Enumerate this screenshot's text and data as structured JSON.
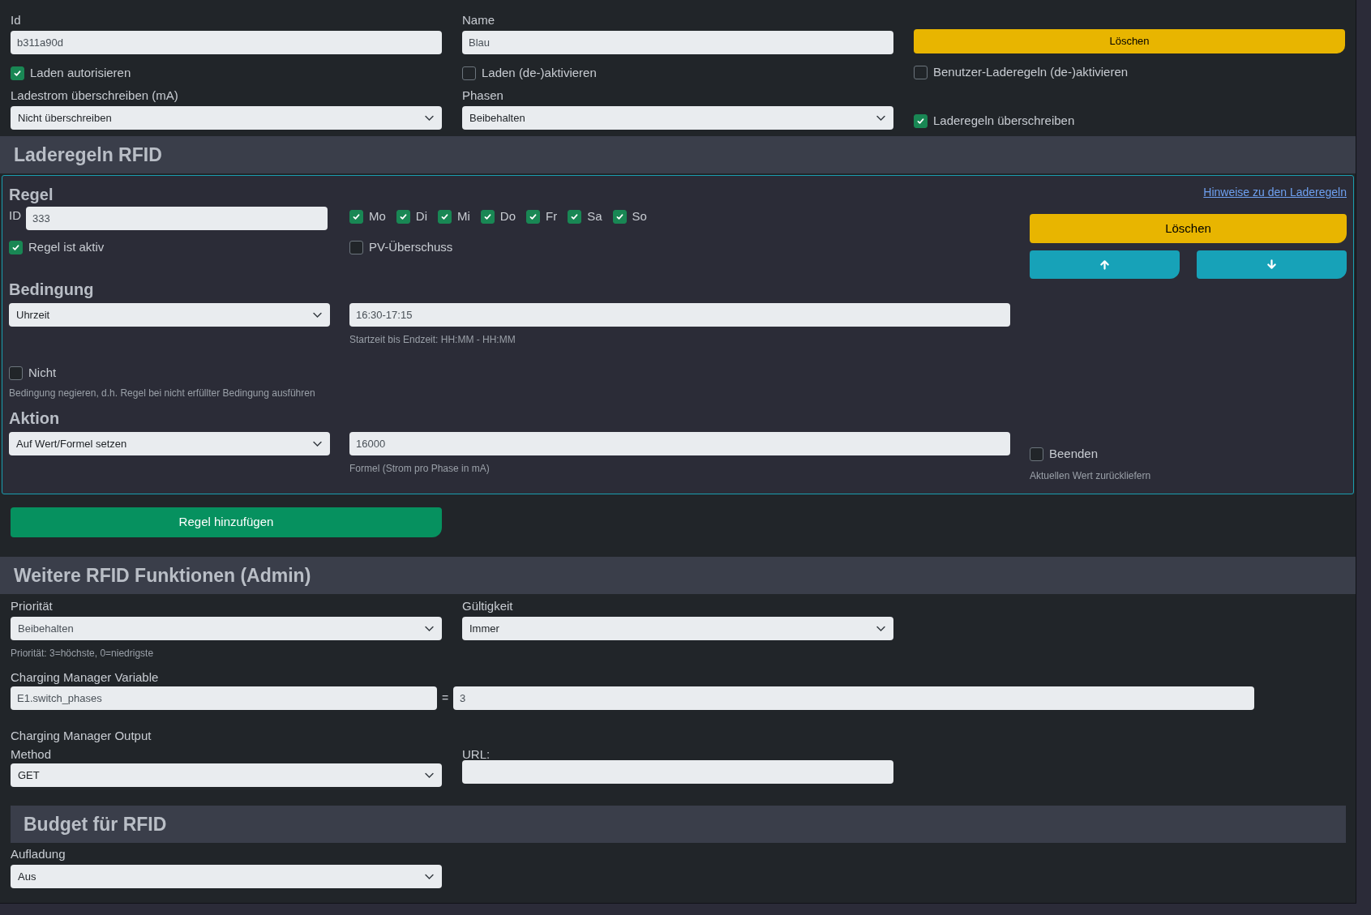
{
  "general": {
    "id_field": {
      "label": "Id",
      "value": "b311a90d"
    },
    "name_field": {
      "label": "Name",
      "value": "Blau"
    },
    "delete_button": "Löschen",
    "checkboxes": [
      {
        "label": "Laden autorisieren",
        "checked": true
      },
      {
        "label": "Laden (de-)aktivieren",
        "checked": false
      },
      {
        "label": "Benutzer-Laderegeln (de-)aktivieren",
        "checked": false
      }
    ],
    "current_override": {
      "label": "Ladestrom überschreiben (mA)",
      "value": "Nicht überschreiben"
    },
    "phases": {
      "label": "Phasen",
      "value": "Beibehalten"
    },
    "override_rules": {
      "label": "Laderegeln überschreiben",
      "checked": true
    }
  },
  "rules_section": {
    "title": "Laderegeln RFID",
    "rule": {
      "heading": "Regel",
      "help_link": "Hinweise zu den Laderegeln",
      "id_label": "ID",
      "id_value": "333",
      "days": [
        {
          "label": "Mo",
          "checked": true
        },
        {
          "label": "Di",
          "checked": true
        },
        {
          "label": "Mi",
          "checked": true
        },
        {
          "label": "Do",
          "checked": true
        },
        {
          "label": "Fr",
          "checked": true
        },
        {
          "label": "Sa",
          "checked": true
        },
        {
          "label": "So",
          "checked": true
        }
      ],
      "active": {
        "label": "Regel ist aktiv",
        "checked": true
      },
      "pv_surplus": {
        "label": "PV-Überschuss",
        "checked": false
      },
      "delete_button": "Löschen",
      "condition": {
        "heading": "Bedingung",
        "type": "Uhrzeit",
        "value": "16:30-17:15",
        "hint": "Startzeit bis Endzeit: HH:MM - HH:MM",
        "negate": {
          "label": "Nicht",
          "checked": false
        },
        "negate_hint": "Bedingung negieren, d.h. Regel bei nicht erfüllter Bedingung ausführen"
      },
      "action": {
        "heading": "Aktion",
        "type": "Auf Wert/Formel setzen",
        "value": "16000",
        "hint": "Formel (Strom pro Phase in mA)",
        "stop": {
          "label": "Beenden",
          "checked": false
        },
        "stop_hint": "Aktuellen Wert zurückliefern"
      }
    },
    "add_button": "Regel hinzufügen"
  },
  "admin_section": {
    "title": "Weitere RFID Funktionen (Admin)",
    "priority": {
      "label": "Priorität",
      "value": "Beibehalten",
      "hint": "Priorität: 3=höchste, 0=niedrigste"
    },
    "validity": {
      "label": "Gültigkeit",
      "value": "Immer"
    },
    "variable": {
      "label": "Charging Manager Variable",
      "name": "E1.switch_phases",
      "equals": "=",
      "value": "3"
    },
    "output": {
      "label": "Charging Manager Output",
      "method_label": "Method",
      "method": "GET",
      "url_label": "URL:"
    }
  },
  "budget_section": {
    "title": "Budget für RFID",
    "charging": {
      "label": "Aufladung",
      "value": "Aus"
    }
  }
}
